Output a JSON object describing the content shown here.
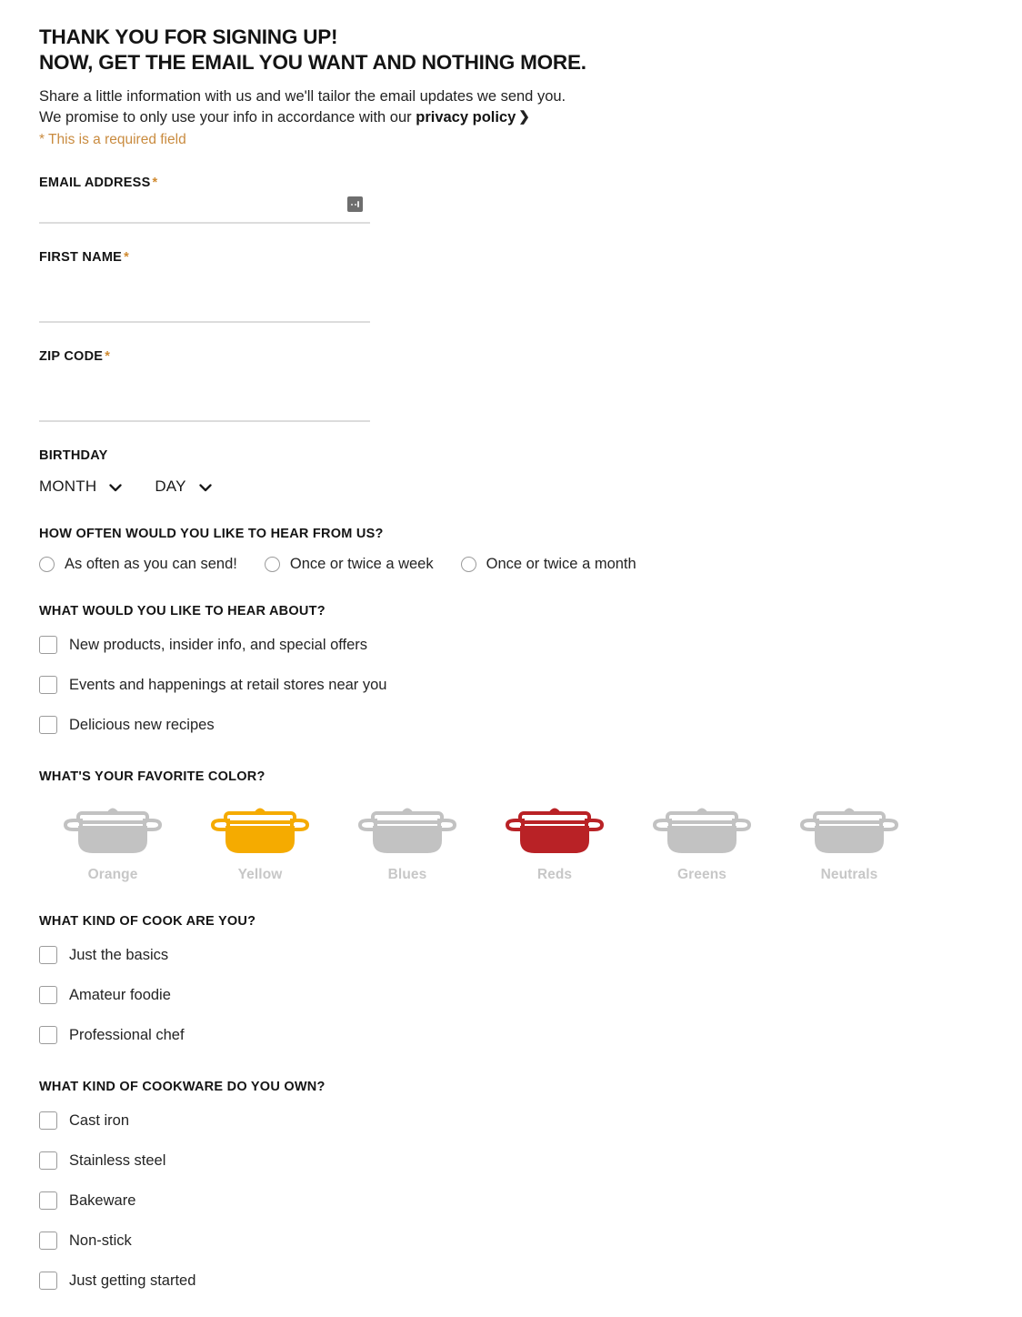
{
  "header": {
    "headline_line1": "THANK YOU FOR SIGNING UP!",
    "headline_line2": "NOW, GET THE EMAIL YOU WANT AND NOTHING MORE.",
    "intro_line1": "Share a little information with us and we'll tailor the email updates we send you.",
    "intro_line2_prefix": "We promise to only use your info in accordance with our ",
    "privacy_link": "privacy policy",
    "chevron_right_icon": "❯",
    "required_note": "* This is a required field"
  },
  "fields": {
    "email": {
      "label": "EMAIL ADDRESS",
      "required_marker": "*",
      "value": "",
      "placeholder": ""
    },
    "first_name": {
      "label": "FIRST NAME",
      "required_marker": "*",
      "value": "",
      "placeholder": ""
    },
    "zip_code": {
      "label": "ZIP CODE",
      "required_marker": "*",
      "value": "",
      "placeholder": ""
    }
  },
  "autofill_icon_name": "autofill-suggestions-icon",
  "birthday": {
    "label": "BIRTHDAY",
    "month_selected": "MONTH",
    "day_selected": "DAY",
    "chevron_down_icon": "⌄"
  },
  "frequency": {
    "title": "HOW OFTEN WOULD YOU LIKE TO HEAR FROM US?",
    "options": [
      {
        "label": "As often as you can send!",
        "selected": false
      },
      {
        "label": "Once or twice a week",
        "selected": false
      },
      {
        "label": "Once or twice a month",
        "selected": false
      }
    ]
  },
  "topics": {
    "title": "WHAT WOULD YOU LIKE TO HEAR ABOUT?",
    "options": [
      {
        "label": "New products, insider info, and special offers",
        "checked": false
      },
      {
        "label": "Events and happenings at retail stores near you",
        "checked": false
      },
      {
        "label": "Delicious new recipes",
        "checked": false
      }
    ]
  },
  "favorite_color": {
    "title": "WHAT'S YOUR FAVORITE COLOR?",
    "options": [
      {
        "label": "Orange",
        "color": "#c2c2c2",
        "selected": false
      },
      {
        "label": "Yellow",
        "color": "#f5ab00",
        "selected": true
      },
      {
        "label": "Blues",
        "color": "#c2c2c2",
        "selected": false
      },
      {
        "label": "Reds",
        "color": "#b92226",
        "selected": true
      },
      {
        "label": "Greens",
        "color": "#c2c2c2",
        "selected": false
      },
      {
        "label": "Neutrals",
        "color": "#c2c2c2",
        "selected": false
      }
    ]
  },
  "cook_type": {
    "title": "WHAT KIND OF COOK ARE YOU?",
    "options": [
      {
        "label": "Just the basics",
        "checked": false
      },
      {
        "label": "Amateur foodie",
        "checked": false
      },
      {
        "label": "Professional chef",
        "checked": false
      }
    ]
  },
  "cookware": {
    "title": "WHAT KIND OF COOKWARE DO YOU OWN?",
    "options": [
      {
        "label": "Cast iron",
        "checked": false
      },
      {
        "label": "Stainless steel",
        "checked": false
      },
      {
        "label": "Bakeware",
        "checked": false
      },
      {
        "label": "Non-stick",
        "checked": false
      },
      {
        "label": "Just getting started",
        "checked": false
      }
    ]
  }
}
